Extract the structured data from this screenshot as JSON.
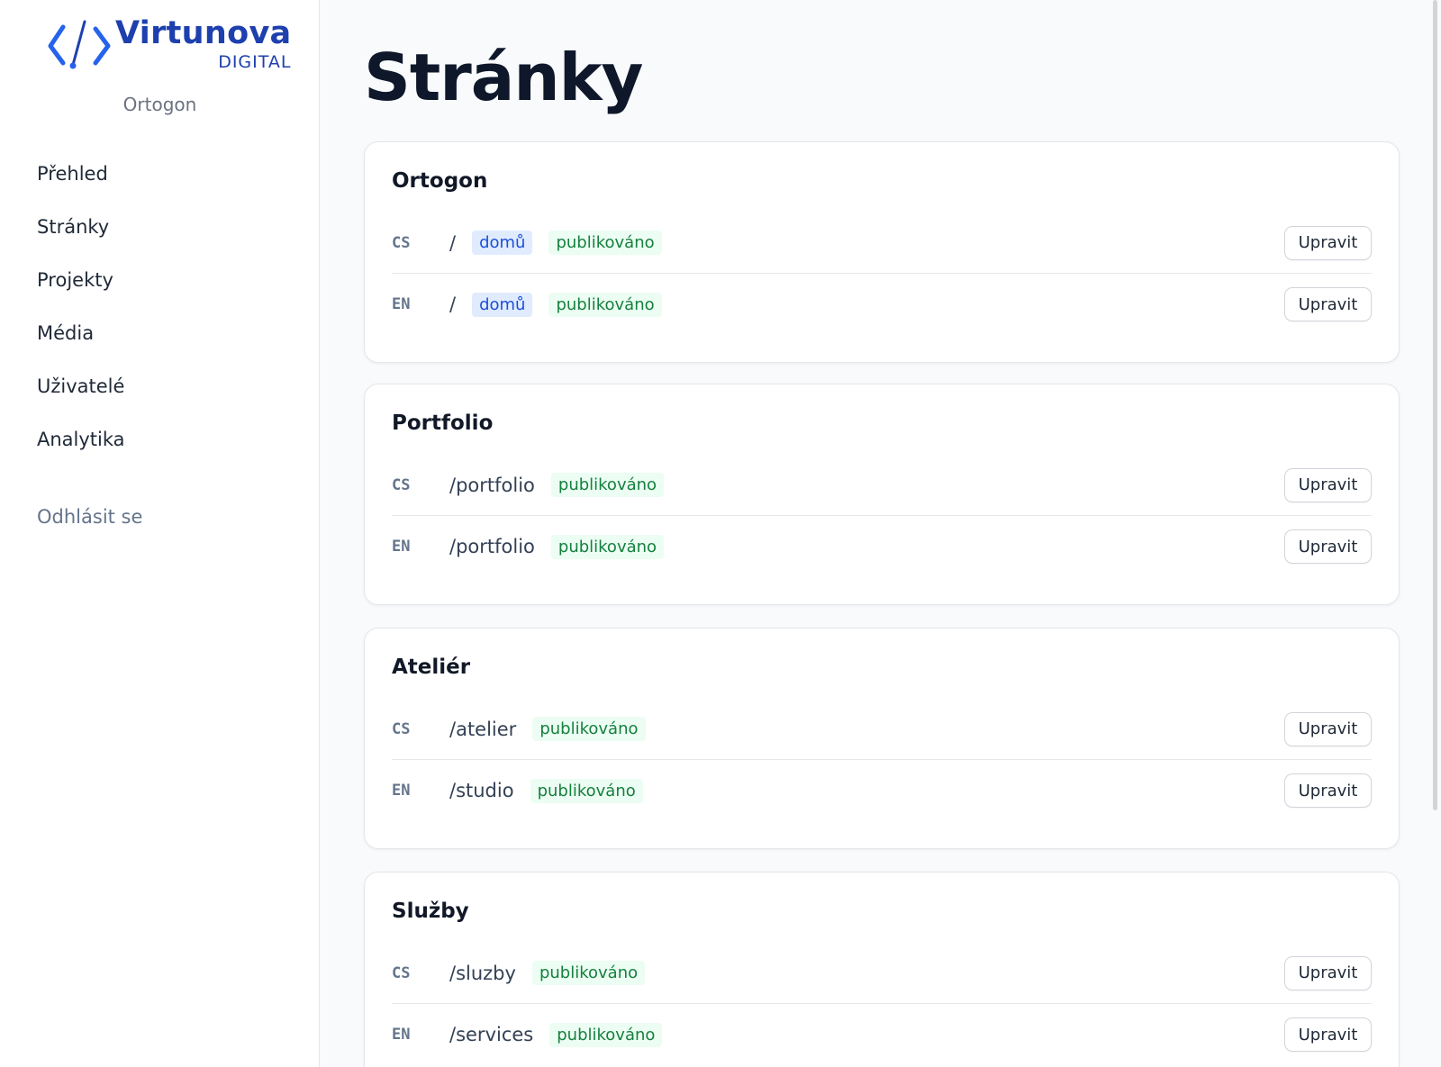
{
  "brand": {
    "name": "Virtunova",
    "sub": "DIGITAL",
    "site": "Ortogon",
    "color": "#1e40af"
  },
  "nav": {
    "items": [
      {
        "label": "Přehled"
      },
      {
        "label": "Stránky"
      },
      {
        "label": "Projekty"
      },
      {
        "label": "Média"
      },
      {
        "label": "Uživatelé"
      },
      {
        "label": "Analytika"
      }
    ],
    "logout": "Odhlásit se"
  },
  "page": {
    "title": "Stránky"
  },
  "sections": [
    {
      "title": "Ortogon",
      "rows": [
        {
          "lang": "CS",
          "path": "/",
          "slug": "domů",
          "status": "publikováno",
          "action": "Upravit"
        },
        {
          "lang": "EN",
          "path": "/",
          "slug": "domů",
          "status": "publikováno",
          "action": "Upravit"
        }
      ]
    },
    {
      "title": "Portfolio",
      "rows": [
        {
          "lang": "CS",
          "path": "/portfolio",
          "status": "publikováno",
          "action": "Upravit"
        },
        {
          "lang": "EN",
          "path": "/portfolio",
          "status": "publikováno",
          "action": "Upravit"
        }
      ]
    },
    {
      "title": "Ateliér",
      "rows": [
        {
          "lang": "CS",
          "path": "/atelier",
          "status": "publikováno",
          "action": "Upravit"
        },
        {
          "lang": "EN",
          "path": "/studio",
          "status": "publikováno",
          "action": "Upravit"
        }
      ]
    },
    {
      "title": "Služby",
      "rows": [
        {
          "lang": "CS",
          "path": "/sluzby",
          "status": "publikováno",
          "action": "Upravit"
        },
        {
          "lang": "EN",
          "path": "/services",
          "status": "publikováno",
          "action": "Upravit"
        }
      ]
    }
  ]
}
